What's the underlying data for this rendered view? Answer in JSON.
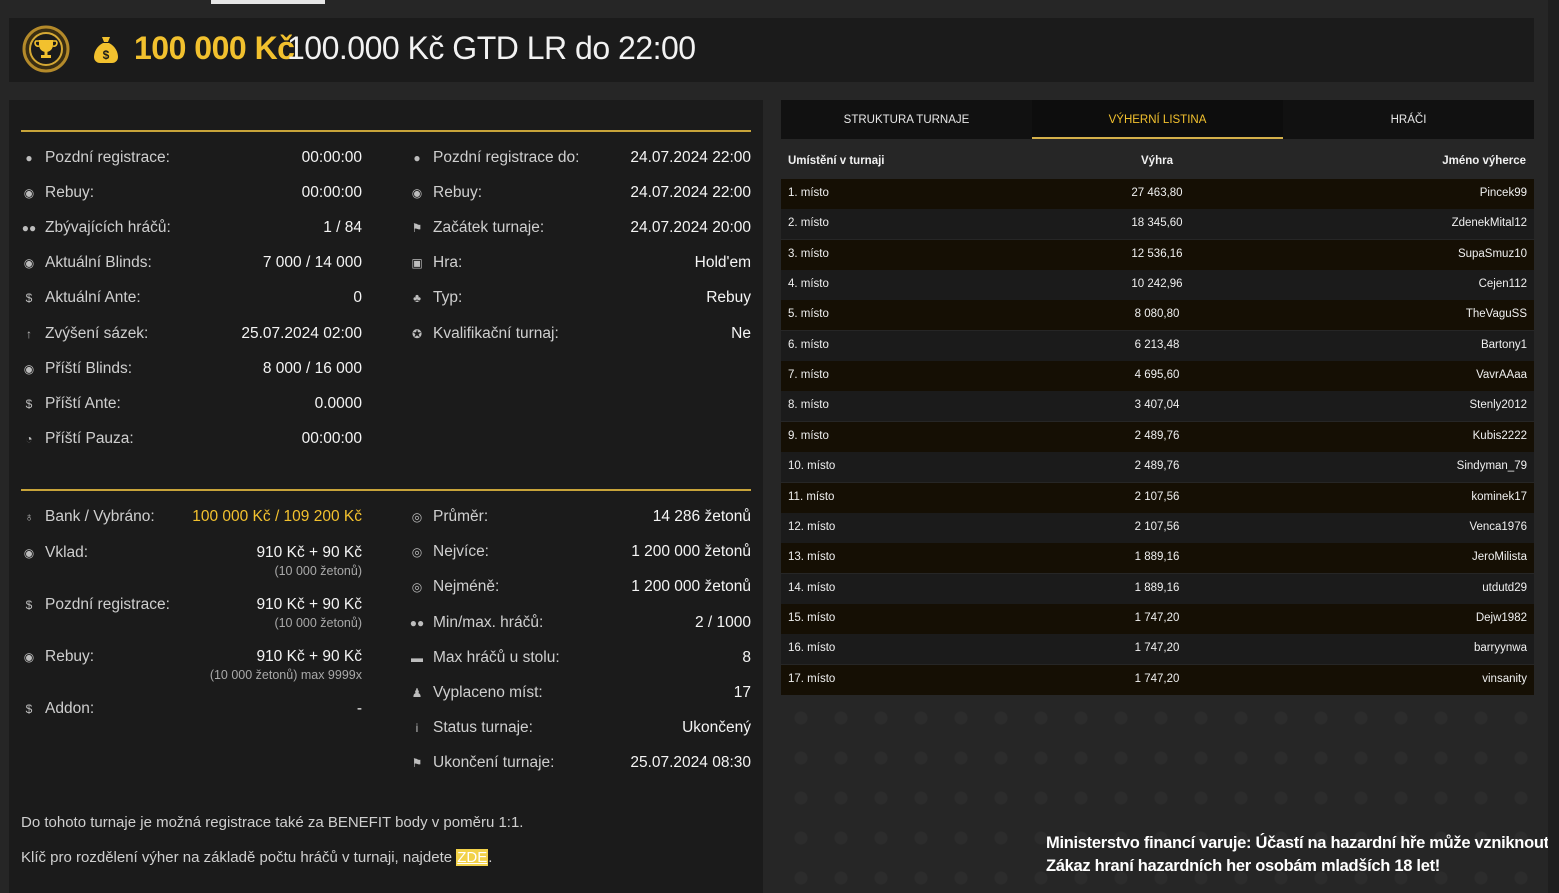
{
  "header": {
    "prize": "100 000 Kč",
    "title": "100.000 Kč GTD LR do 22:00",
    "logo_icon": "trophy-icon",
    "bag_icon": "money-bag-icon"
  },
  "info_left": [
    {
      "icon": "user-icon",
      "label": "Pozdní registrace:",
      "value": "00:00:00"
    },
    {
      "icon": "chips-icon",
      "label": "Rebuy:",
      "value": "00:00:00"
    },
    {
      "icon": "users-icon",
      "label": "Zbývajících hráčů:",
      "value": "1 / 84"
    },
    {
      "icon": "chips-icon",
      "label": "Aktuální Blinds:",
      "value": "7 000 / 14 000"
    },
    {
      "icon": "coin-icon",
      "label": "Aktuální Ante:",
      "value": "0"
    },
    {
      "icon": "arrow-up-icon",
      "label": "Zvýšení sázek:",
      "value": "25.07.2024 02:00"
    },
    {
      "icon": "chips-icon",
      "label": "Příští Blinds:",
      "value": "8 000 / 16 000"
    },
    {
      "icon": "coin-icon",
      "label": "Příští Ante:",
      "value": "0.0000"
    },
    {
      "icon": "clock-icon",
      "label": "Příští Pauza:",
      "value": "00:00:00"
    }
  ],
  "info_right": [
    {
      "icon": "user-icon",
      "label": "Pozdní registrace do:",
      "value": "24.07.2024 22:00"
    },
    {
      "icon": "chips-icon",
      "label": "Rebuy:",
      "value": "24.07.2024 22:00"
    },
    {
      "icon": "flag-icon",
      "label": "Začátek turnaje:",
      "value": "24.07.2024 20:00"
    },
    {
      "icon": "cards-icon",
      "label": "Hra:",
      "value": "Hold'em"
    },
    {
      "icon": "suits-icon",
      "label": "Typ:",
      "value": "Rebuy"
    },
    {
      "icon": "medal-icon",
      "label": "Kvalifikační turnaj:",
      "value": "Ne"
    }
  ],
  "money_left": [
    {
      "icon": "money-bag-icon",
      "label": "Bank / Vybráno:",
      "value": "100 000 Kč / 109 200 Kč",
      "sub": ""
    },
    {
      "icon": "chips-icon",
      "label": "Vklad:",
      "value": "910 Kč + 90 Kč",
      "sub": "(10 000 žetonů)"
    },
    {
      "icon": "coin-icon",
      "label": "Pozdní registrace:",
      "value": "910 Kč + 90 Kč",
      "sub": "(10 000 žetonů)"
    },
    {
      "icon": "chips-icon",
      "label": "Rebuy:",
      "value": "910 Kč + 90 Kč",
      "sub": "(10 000 žetonů) max 9999x"
    },
    {
      "icon": "coin-icon",
      "label": "Addon:",
      "value": "-",
      "sub": ""
    }
  ],
  "money_right": [
    {
      "icon": "chip-icon",
      "label": "Průměr:",
      "value": "14 286 žetonů"
    },
    {
      "icon": "chip-icon",
      "label": "Nejvíce:",
      "value": "1 200 000 žetonů"
    },
    {
      "icon": "chip-icon",
      "label": "Nejméně:",
      "value": "1 200 000 žetonů"
    },
    {
      "icon": "users-icon",
      "label": "Min/max. hráčů:",
      "value": "2 / 1000"
    },
    {
      "icon": "table-icon",
      "label": "Max hráčů u stolu:",
      "value": "8"
    },
    {
      "icon": "payout-icon",
      "label": "Vyplaceno míst:",
      "value": "17"
    },
    {
      "icon": "info-icon",
      "label": "Status turnaje:",
      "value": "Ukončený"
    },
    {
      "icon": "flag-icon",
      "label": "Ukončení turnaje:",
      "value": "25.07.2024 08:30"
    }
  ],
  "notes": {
    "benefit": "Do tohoto turnaje je možná registrace také za BENEFIT body v poměru 1:1.",
    "key_text": "Klíč pro rozdělení výher na základě počtu hráčů v turnaji, najdete",
    "key_link": "ZDE",
    "key_end": "."
  },
  "tabs": [
    {
      "label": "STRUKTURA TURNAJE",
      "active": false
    },
    {
      "label": "VÝHERNÍ LISTINA",
      "active": true
    },
    {
      "label": "HRÁČI",
      "active": false
    }
  ],
  "results": {
    "headers": [
      "Umístění v turnaji",
      "Výhra",
      "Jméno výherce"
    ],
    "rows": [
      [
        "1. místo",
        "27 463,80",
        "Pincek99"
      ],
      [
        "2. místo",
        "18 345,60",
        "ZdenekMital12"
      ],
      [
        "3. místo",
        "12 536,16",
        "SupaSmuz10"
      ],
      [
        "4. místo",
        "10 242,96",
        "Cejen112"
      ],
      [
        "5. místo",
        "8 080,80",
        "TheVaguSS"
      ],
      [
        "6. místo",
        "6 213,48",
        "Bartony1"
      ],
      [
        "7. místo",
        "4 695,60",
        "VavrAAaa"
      ],
      [
        "8. místo",
        "3 407,04",
        "Stenly2012"
      ],
      [
        "9. místo",
        "2 489,76",
        "Kubis2222"
      ],
      [
        "10. místo",
        "2 489,76",
        "Sindyman_79"
      ],
      [
        "11. místo",
        "2 107,56",
        "kominek17"
      ],
      [
        "12. místo",
        "2 107,56",
        "Venca1976"
      ],
      [
        "13. místo",
        "1 889,16",
        "JeroMilista"
      ],
      [
        "14. místo",
        "1 889,16",
        "utdutd29"
      ],
      [
        "15. místo",
        "1 747,20",
        "Dejw1982"
      ],
      [
        "16. místo",
        "1 747,20",
        "barryynwa"
      ],
      [
        "17. místo",
        "1 747,20",
        "vinsanity"
      ]
    ]
  },
  "warning": {
    "line1": "Ministerstvo financí varuje: Účastí na hazardní hře může vzniknout závislost!",
    "line2": "Zákaz hraní hazardních her osobám mladších 18 let!"
  },
  "colors": {
    "accent": "#f2c12e",
    "panel": "#1b1b1b",
    "row_odd": "#150f04"
  }
}
